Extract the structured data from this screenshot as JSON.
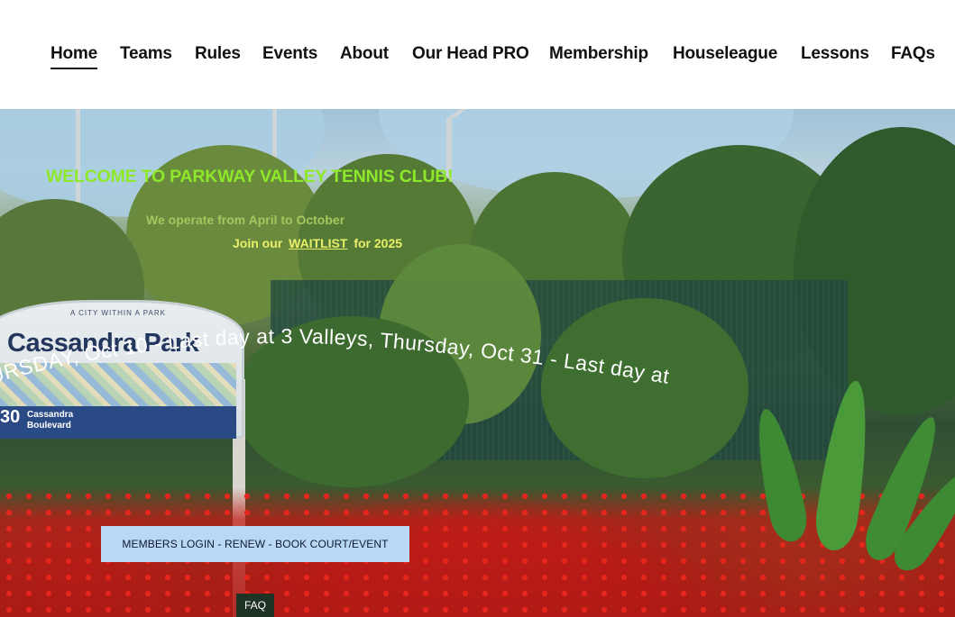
{
  "nav": {
    "items": [
      {
        "label": "Home",
        "active": true
      },
      {
        "label": "Teams"
      },
      {
        "label": "Rules"
      },
      {
        "label": "Events"
      },
      {
        "label": "About"
      },
      {
        "label": "Our Head PRO"
      },
      {
        "label": "Membership"
      },
      {
        "label": "Houseleague"
      },
      {
        "label": "Lessons"
      },
      {
        "label": "FAQs"
      }
    ]
  },
  "hero": {
    "welcome": "WELCOME TO PARKWAY VALLEY TENNIS CLUB!",
    "operate": "We operate from April to October",
    "waitlist_prefix": "Join our",
    "waitlist_link": "WAITLIST",
    "waitlist_suffix": "for 2025",
    "marquee": "URSDAY, Oct 10 -  Last day at 3 Valleys, Thursday, Oct 31 -  Last day at",
    "members_button": "MEMBERS LOGIN - RENEW - BOOK COURT/EVENT",
    "faq_button": "FAQ",
    "sign": {
      "top": "A CITY WITHIN A PARK",
      "name": "Cassandra Park",
      "number": "30",
      "street": "Cassandra Boulevard"
    },
    "colors": {
      "welcome": "#8ee82a",
      "operate": "#a4c85e",
      "waitlist": "#e8f06a",
      "button_bg": "#b9d8f5"
    }
  }
}
